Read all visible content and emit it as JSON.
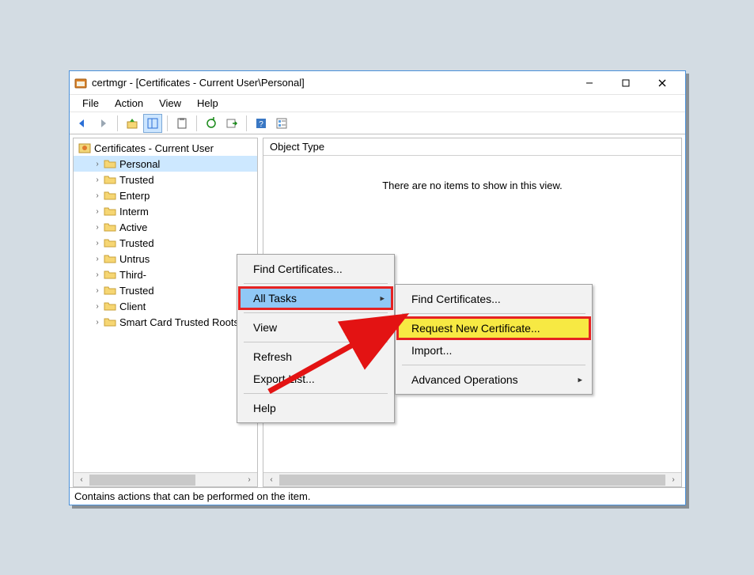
{
  "title": "certmgr - [Certificates - Current User\\Personal]",
  "menubar": {
    "file": "File",
    "action": "Action",
    "view": "View",
    "help": "Help"
  },
  "toolbar_icons": {
    "back": "back",
    "forward": "forward",
    "up": "up-folder",
    "properties": "properties-pane",
    "clipboard": "clipboard",
    "refresh": "refresh",
    "export": "export",
    "help": "help",
    "objects": "objects-list"
  },
  "tree": {
    "root": "Certificates - Current User",
    "items": [
      "Personal",
      "Trusted",
      "Enterp",
      "Interm",
      "Active",
      "Trusted",
      "Untrus",
      "Third-",
      "Trusted",
      "Client",
      "Smart Card Trusted Roots"
    ]
  },
  "list": {
    "header": "Object Type",
    "empty": "There are no items to show in this view."
  },
  "status": "Contains actions that can be performed on the item.",
  "context_menu": {
    "find_certificates": "Find Certificates...",
    "all_tasks": "All Tasks",
    "view": "View",
    "refresh": "Refresh",
    "export_list": "Export List...",
    "help": "Help"
  },
  "submenu": {
    "find_certificates": "Find Certificates...",
    "request_new": "Request New Certificate...",
    "import": "Import...",
    "advanced": "Advanced Operations"
  }
}
